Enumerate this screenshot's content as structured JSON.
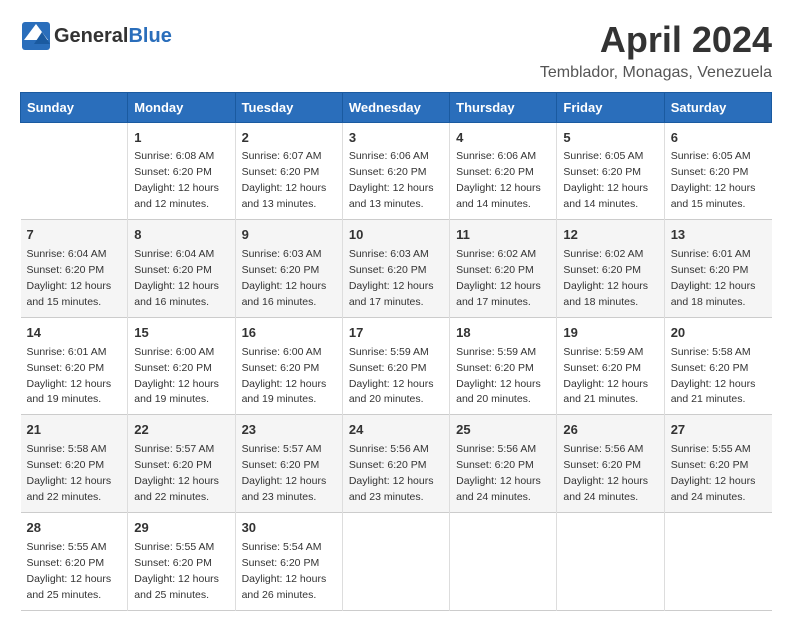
{
  "header": {
    "logo_general": "General",
    "logo_blue": "Blue",
    "title": "April 2024",
    "location": "Temblador, Monagas, Venezuela"
  },
  "columns": [
    "Sunday",
    "Monday",
    "Tuesday",
    "Wednesday",
    "Thursday",
    "Friday",
    "Saturday"
  ],
  "weeks": [
    [
      {
        "num": "",
        "detail": ""
      },
      {
        "num": "1",
        "detail": "Sunrise: 6:08 AM\nSunset: 6:20 PM\nDaylight: 12 hours\nand 12 minutes."
      },
      {
        "num": "2",
        "detail": "Sunrise: 6:07 AM\nSunset: 6:20 PM\nDaylight: 12 hours\nand 13 minutes."
      },
      {
        "num": "3",
        "detail": "Sunrise: 6:06 AM\nSunset: 6:20 PM\nDaylight: 12 hours\nand 13 minutes."
      },
      {
        "num": "4",
        "detail": "Sunrise: 6:06 AM\nSunset: 6:20 PM\nDaylight: 12 hours\nand 14 minutes."
      },
      {
        "num": "5",
        "detail": "Sunrise: 6:05 AM\nSunset: 6:20 PM\nDaylight: 12 hours\nand 14 minutes."
      },
      {
        "num": "6",
        "detail": "Sunrise: 6:05 AM\nSunset: 6:20 PM\nDaylight: 12 hours\nand 15 minutes."
      }
    ],
    [
      {
        "num": "7",
        "detail": "Sunrise: 6:04 AM\nSunset: 6:20 PM\nDaylight: 12 hours\nand 15 minutes."
      },
      {
        "num": "8",
        "detail": "Sunrise: 6:04 AM\nSunset: 6:20 PM\nDaylight: 12 hours\nand 16 minutes."
      },
      {
        "num": "9",
        "detail": "Sunrise: 6:03 AM\nSunset: 6:20 PM\nDaylight: 12 hours\nand 16 minutes."
      },
      {
        "num": "10",
        "detail": "Sunrise: 6:03 AM\nSunset: 6:20 PM\nDaylight: 12 hours\nand 17 minutes."
      },
      {
        "num": "11",
        "detail": "Sunrise: 6:02 AM\nSunset: 6:20 PM\nDaylight: 12 hours\nand 17 minutes."
      },
      {
        "num": "12",
        "detail": "Sunrise: 6:02 AM\nSunset: 6:20 PM\nDaylight: 12 hours\nand 18 minutes."
      },
      {
        "num": "13",
        "detail": "Sunrise: 6:01 AM\nSunset: 6:20 PM\nDaylight: 12 hours\nand 18 minutes."
      }
    ],
    [
      {
        "num": "14",
        "detail": "Sunrise: 6:01 AM\nSunset: 6:20 PM\nDaylight: 12 hours\nand 19 minutes."
      },
      {
        "num": "15",
        "detail": "Sunrise: 6:00 AM\nSunset: 6:20 PM\nDaylight: 12 hours\nand 19 minutes."
      },
      {
        "num": "16",
        "detail": "Sunrise: 6:00 AM\nSunset: 6:20 PM\nDaylight: 12 hours\nand 19 minutes."
      },
      {
        "num": "17",
        "detail": "Sunrise: 5:59 AM\nSunset: 6:20 PM\nDaylight: 12 hours\nand 20 minutes."
      },
      {
        "num": "18",
        "detail": "Sunrise: 5:59 AM\nSunset: 6:20 PM\nDaylight: 12 hours\nand 20 minutes."
      },
      {
        "num": "19",
        "detail": "Sunrise: 5:59 AM\nSunset: 6:20 PM\nDaylight: 12 hours\nand 21 minutes."
      },
      {
        "num": "20",
        "detail": "Sunrise: 5:58 AM\nSunset: 6:20 PM\nDaylight: 12 hours\nand 21 minutes."
      }
    ],
    [
      {
        "num": "21",
        "detail": "Sunrise: 5:58 AM\nSunset: 6:20 PM\nDaylight: 12 hours\nand 22 minutes."
      },
      {
        "num": "22",
        "detail": "Sunrise: 5:57 AM\nSunset: 6:20 PM\nDaylight: 12 hours\nand 22 minutes."
      },
      {
        "num": "23",
        "detail": "Sunrise: 5:57 AM\nSunset: 6:20 PM\nDaylight: 12 hours\nand 23 minutes."
      },
      {
        "num": "24",
        "detail": "Sunrise: 5:56 AM\nSunset: 6:20 PM\nDaylight: 12 hours\nand 23 minutes."
      },
      {
        "num": "25",
        "detail": "Sunrise: 5:56 AM\nSunset: 6:20 PM\nDaylight: 12 hours\nand 24 minutes."
      },
      {
        "num": "26",
        "detail": "Sunrise: 5:56 AM\nSunset: 6:20 PM\nDaylight: 12 hours\nand 24 minutes."
      },
      {
        "num": "27",
        "detail": "Sunrise: 5:55 AM\nSunset: 6:20 PM\nDaylight: 12 hours\nand 24 minutes."
      }
    ],
    [
      {
        "num": "28",
        "detail": "Sunrise: 5:55 AM\nSunset: 6:20 PM\nDaylight: 12 hours\nand 25 minutes."
      },
      {
        "num": "29",
        "detail": "Sunrise: 5:55 AM\nSunset: 6:20 PM\nDaylight: 12 hours\nand 25 minutes."
      },
      {
        "num": "30",
        "detail": "Sunrise: 5:54 AM\nSunset: 6:20 PM\nDaylight: 12 hours\nand 26 minutes."
      },
      {
        "num": "",
        "detail": ""
      },
      {
        "num": "",
        "detail": ""
      },
      {
        "num": "",
        "detail": ""
      },
      {
        "num": "",
        "detail": ""
      }
    ]
  ]
}
